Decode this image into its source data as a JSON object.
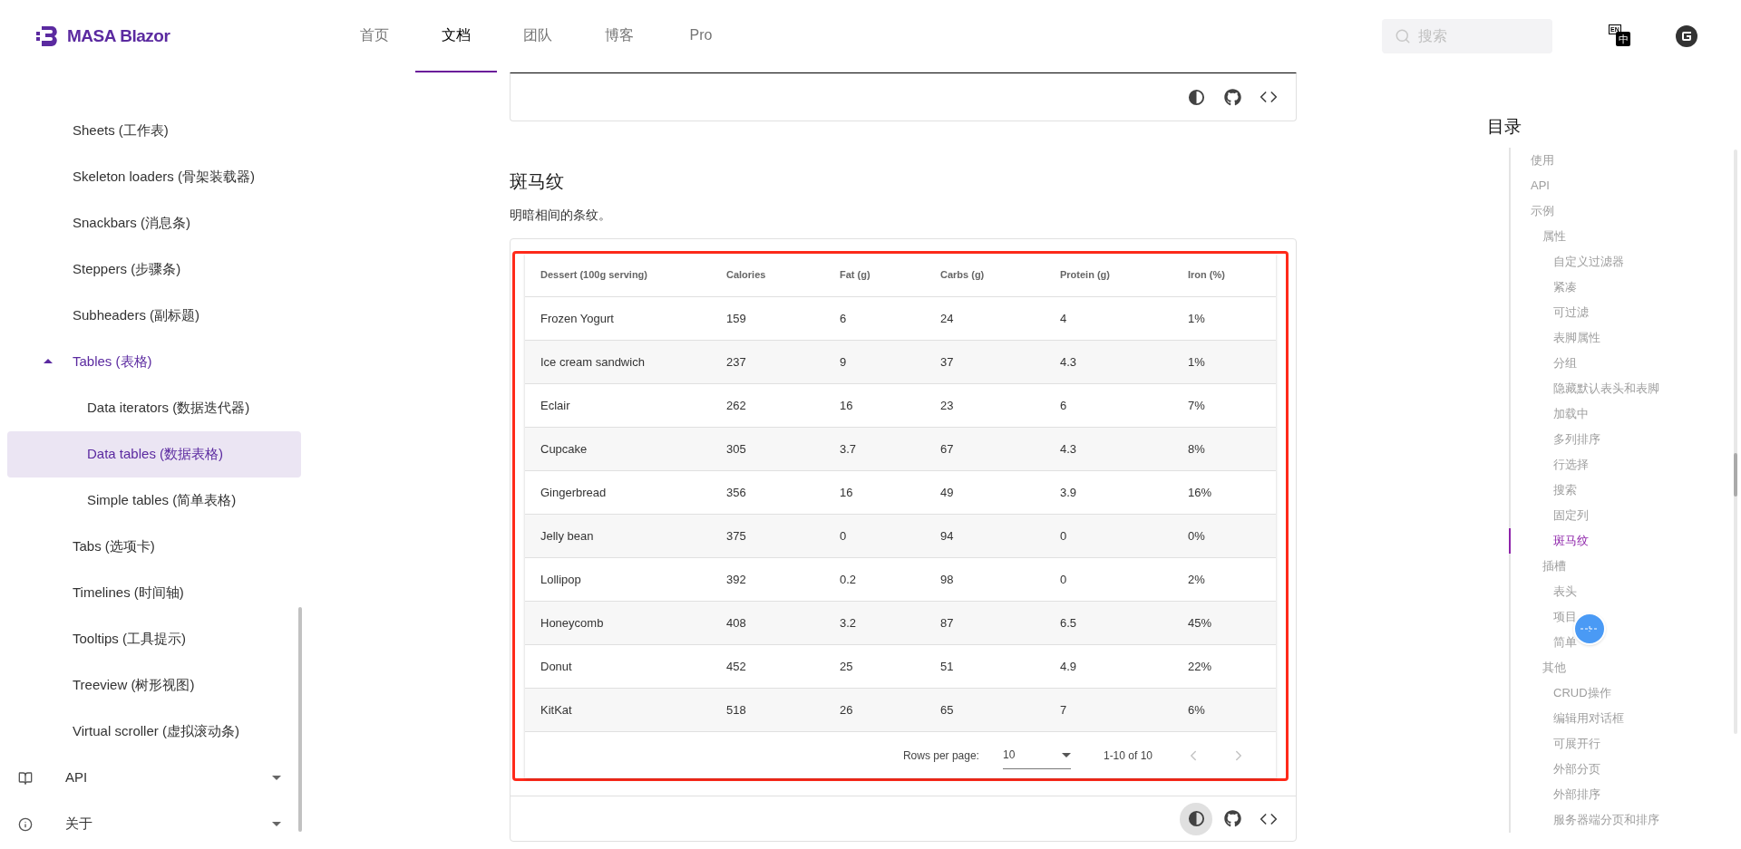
{
  "header": {
    "logo": "MASA Blazor",
    "nav": [
      {
        "label": "首页",
        "selected": false
      },
      {
        "label": "文档",
        "selected": true
      },
      {
        "label": "团队",
        "selected": false
      },
      {
        "label": "博客",
        "selected": false
      },
      {
        "label": "Pro",
        "selected": false
      }
    ],
    "search": {
      "placeholder": "搜索"
    },
    "language_button": {
      "top": "EN",
      "bottom": "中"
    }
  },
  "sidebar": {
    "items": [
      {
        "label": "Sheets (工作表)",
        "selected": false
      },
      {
        "label": "Skeleton loaders (骨架装载器)",
        "selected": false
      },
      {
        "label": "Snackbars (消息条)",
        "selected": false
      },
      {
        "label": "Steppers (步骤条)",
        "selected": false
      },
      {
        "label": "Subheaders (副标题)",
        "selected": false
      },
      {
        "label": "Tables (表格)",
        "selected": false,
        "expanded": true,
        "children": [
          {
            "label": "Data iterators (数据迭代器)",
            "selected": false
          },
          {
            "label": "Data tables (数据表格)",
            "selected": true
          },
          {
            "label": "Simple tables (简单表格)",
            "selected": false
          }
        ]
      },
      {
        "label": "Tabs (选项卡)",
        "selected": false
      },
      {
        "label": "Timelines (时间轴)",
        "selected": false
      },
      {
        "label": "Tooltips (工具提示)",
        "selected": false
      },
      {
        "label": "Treeview (树形视图)",
        "selected": false
      },
      {
        "label": "Virtual scroller (虚拟滚动条)",
        "selected": false
      }
    ],
    "groups": [
      {
        "label": "API",
        "kind": "book",
        "expanded": false
      },
      {
        "label": "关于",
        "kind": "info",
        "expanded": false
      }
    ]
  },
  "previous_example": {
    "toolbar": [
      {
        "kind": "theme",
        "selected": false
      },
      {
        "kind": "github",
        "selected": false
      },
      {
        "kind": "code",
        "selected": false
      }
    ]
  },
  "section": {
    "title": "斑马纹",
    "description": "明暗相间的条纹。",
    "table": {
      "columns": [
        "Dessert (100g serving)",
        "Calories",
        "Fat (g)",
        "Carbs (g)",
        "Protein (g)",
        "Iron (%)"
      ],
      "rows": [
        [
          "Frozen Yogurt",
          "159",
          "6",
          "24",
          "4",
          "1%"
        ],
        [
          "Ice cream sandwich",
          "237",
          "9",
          "37",
          "4.3",
          "1%"
        ],
        [
          "Eclair",
          "262",
          "16",
          "23",
          "6",
          "7%"
        ],
        [
          "Cupcake",
          "305",
          "3.7",
          "67",
          "4.3",
          "8%"
        ],
        [
          "Gingerbread",
          "356",
          "16",
          "49",
          "3.9",
          "16%"
        ],
        [
          "Jelly bean",
          "375",
          "0",
          "94",
          "0",
          "0%"
        ],
        [
          "Lollipop",
          "392",
          "0.2",
          "98",
          "0",
          "2%"
        ],
        [
          "Honeycomb",
          "408",
          "3.2",
          "87",
          "6.5",
          "45%"
        ],
        [
          "Donut",
          "452",
          "25",
          "51",
          "4.9",
          "22%"
        ],
        [
          "KitKat",
          "518",
          "26",
          "65",
          "7",
          "6%"
        ]
      ],
      "footer": {
        "rows_per_page_label": "Rows per page:",
        "rows_per_page": "10",
        "range": "1-10 of 10",
        "prev_disabled": true,
        "next_disabled": true
      }
    },
    "toolbar": [
      {
        "kind": "theme",
        "selected": true
      },
      {
        "kind": "github",
        "selected": false
      },
      {
        "kind": "code",
        "selected": false
      }
    ]
  },
  "toc": {
    "title": "目录",
    "items": [
      {
        "label": "使用",
        "selected": false
      },
      {
        "label": "API",
        "selected": false
      },
      {
        "label": "示例",
        "selected": false,
        "children": [
          {
            "label": "属性",
            "selected": false,
            "children": [
              {
                "label": "自定义过滤器",
                "selected": false
              },
              {
                "label": "紧凑",
                "selected": false
              },
              {
                "label": "可过滤",
                "selected": false
              },
              {
                "label": "表脚属性",
                "selected": false
              },
              {
                "label": "分组",
                "selected": false
              },
              {
                "label": "隐藏默认表头和表脚",
                "selected": false
              },
              {
                "label": "加载中",
                "selected": false
              },
              {
                "label": "多列排序",
                "selected": false
              },
              {
                "label": "行选择",
                "selected": false
              },
              {
                "label": "搜索",
                "selected": false
              },
              {
                "label": "固定列",
                "selected": false
              },
              {
                "label": "斑马纹",
                "selected": true
              }
            ]
          },
          {
            "label": "插槽",
            "selected": false,
            "children": [
              {
                "label": "表头",
                "selected": false
              },
              {
                "label": "项目",
                "selected": false
              },
              {
                "label": "简单",
                "selected": false
              }
            ]
          },
          {
            "label": "其他",
            "selected": false,
            "children": [
              {
                "label": "CRUD操作",
                "selected": false
              },
              {
                "label": "编辑用对话框",
                "selected": false
              },
              {
                "label": "可展开行",
                "selected": false
              },
              {
                "label": "外部分页",
                "selected": false
              },
              {
                "label": "外部排序",
                "selected": false
              },
              {
                "label": "服务器端分页和排序",
                "selected": false
              }
            ]
          }
        ]
      }
    ]
  }
}
